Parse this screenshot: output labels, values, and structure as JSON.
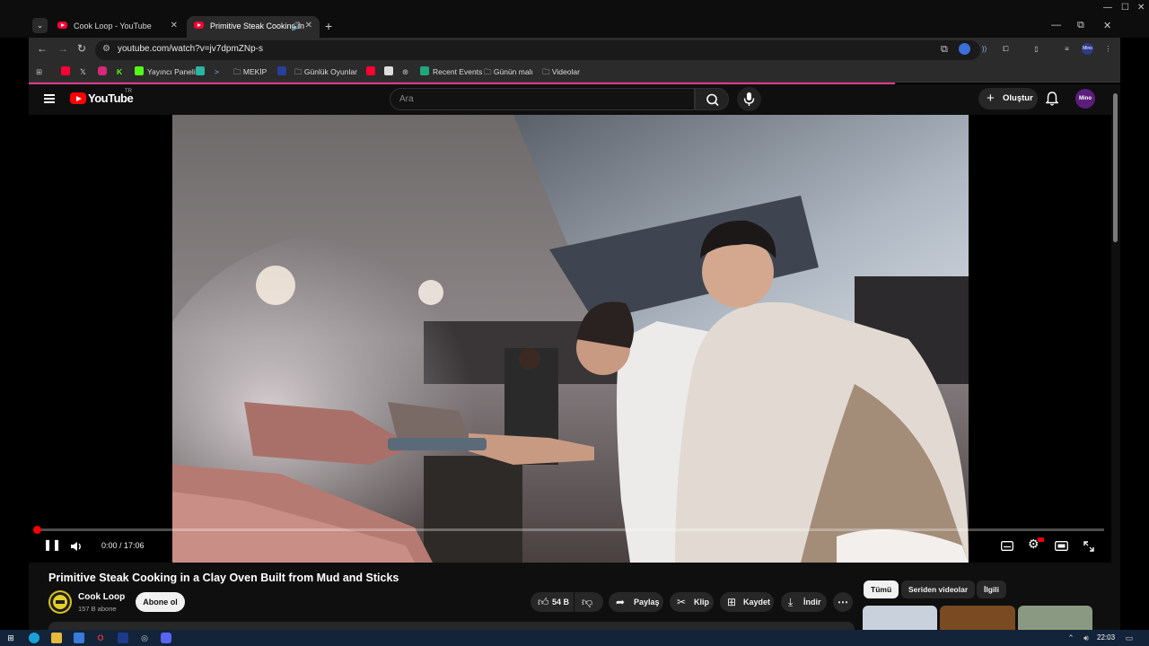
{
  "browser": {
    "tabs": [
      {
        "title": "Cook Loop - YouTube",
        "active": false
      },
      {
        "title": "Primitive Steak Cooking in",
        "active": true
      }
    ],
    "url": "youtube.com/watch?v=jv7dpmZNp-s",
    "bookmarks": [
      "Yayıncı Paneli",
      "MEKİP",
      "Günlük Oyunlar",
      "Recent Events",
      "Günün malı",
      "Videolar"
    ]
  },
  "youtube": {
    "logo_text": "YouTube",
    "country_code": "TR",
    "search_placeholder": "Ara",
    "create_label": "Oluştur",
    "avatar_text": "Mino"
  },
  "player": {
    "time_current": "0:00",
    "time_total": "17:06",
    "time_display": "0:00 / 17:06",
    "progress": 0.0
  },
  "video": {
    "title": "Primitive Steak Cooking in a Clay Oven Built from Mud and Sticks",
    "channel_name": "Cook Loop",
    "subscribers": "157 B abone",
    "subscribe_label": "Abone ol",
    "likes": "54 B",
    "share_label": "Paylaş",
    "clip_label": "Klip",
    "save_label": "Kaydet",
    "download_label": "İndir"
  },
  "related_chips": [
    "Tümü",
    "Seriden videolar",
    "İlgili"
  ],
  "taskbar": {
    "clock": "22:03"
  },
  "colors": {
    "yt_red": "#ff0000",
    "bg": "#0f0f0f",
    "chip_bg": "#272727",
    "taskbar": "#13243a"
  }
}
